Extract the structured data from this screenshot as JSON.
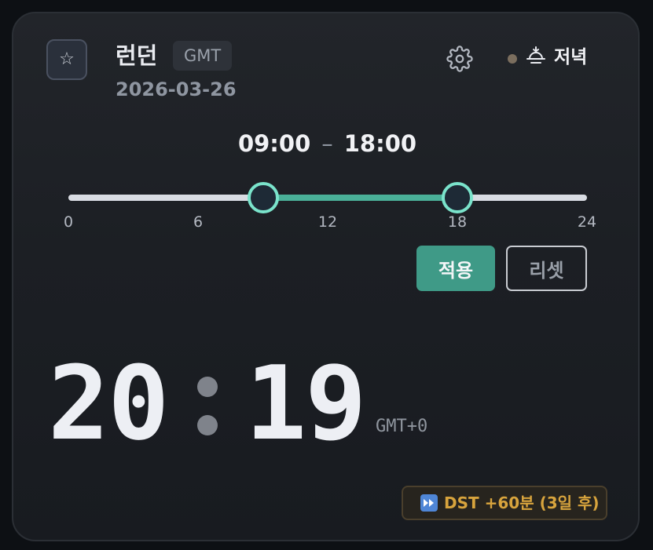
{
  "header": {
    "favorite_icon": "star-outline-icon",
    "city": "런던",
    "tz_abbrev": "GMT",
    "date": "2026-03-26",
    "settings_icon": "gear-icon",
    "period_icon": "sunset-icon",
    "period_label": "저녁",
    "period_dot_color": "#7b6e5e"
  },
  "work_hours": {
    "start": "09:00",
    "separator": "–",
    "end": "18:00",
    "slider_min": 0,
    "slider_max": 24,
    "start_value": 9,
    "end_value": 18,
    "ticks": [
      "0",
      "6",
      "12",
      "18",
      "24"
    ],
    "track_color": "#d9dce3",
    "fill_color": "#4aaf98",
    "thumb_border_color": "#7ae3cb"
  },
  "actions": {
    "apply_label": "적용",
    "reset_label": "리셋",
    "apply_color": "#3f9a87"
  },
  "clock": {
    "hours": "20",
    "minutes": "19",
    "offset": "GMT+0"
  },
  "dst": {
    "icon": "fast-forward-icon",
    "text": "DST +60분 (3일 후)",
    "color": "#d8a43d"
  }
}
